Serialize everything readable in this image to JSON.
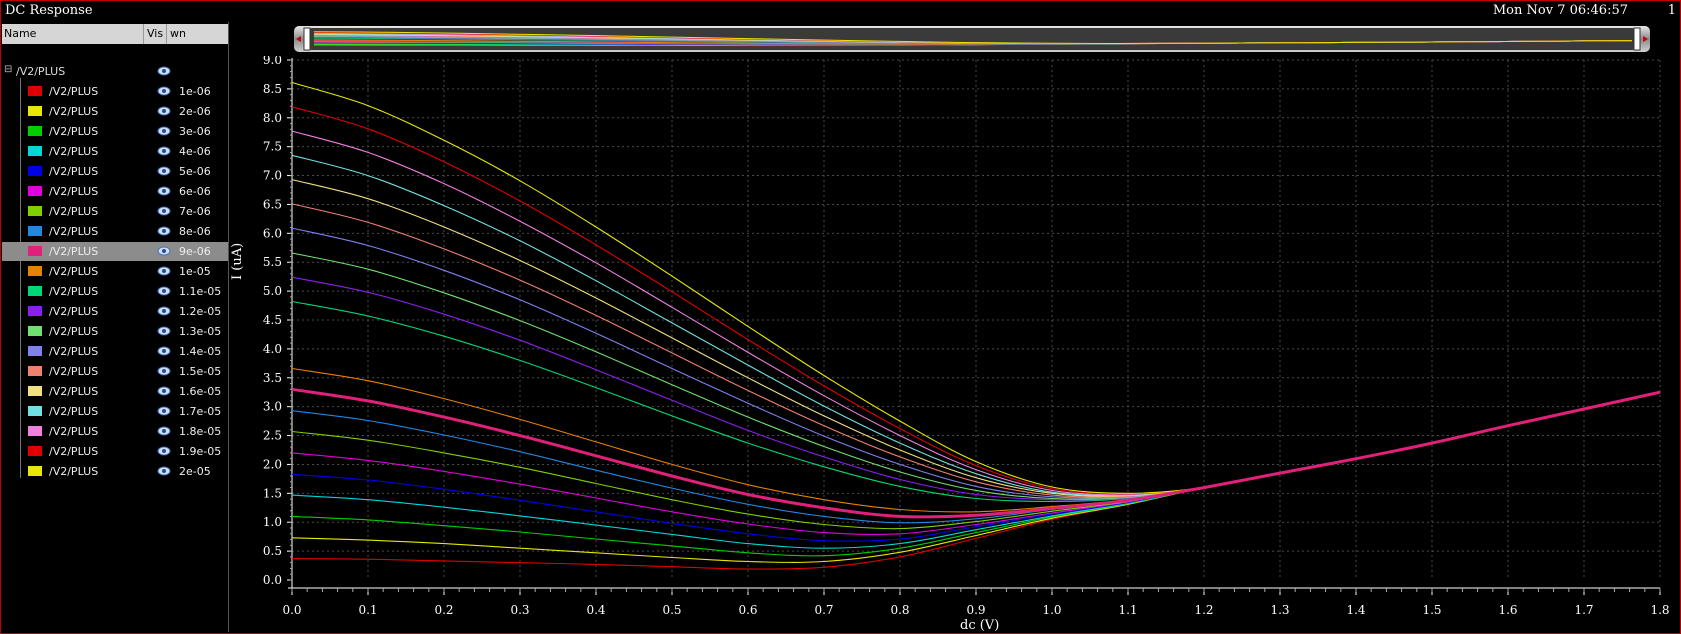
{
  "window": {
    "title": "DC Response",
    "timestamp": "Mon Nov 7 06:46:57",
    "page_number": "1"
  },
  "sidebar": {
    "headers": {
      "name": "Name",
      "vis": "Vis",
      "param": "wn"
    },
    "group": {
      "label": "/V2/PLUS",
      "expander": "⊟"
    },
    "items": [
      {
        "label": "/V2/PLUS",
        "value": "1e-06",
        "color": "#e00000"
      },
      {
        "label": "/V2/PLUS",
        "value": "2e-06",
        "color": "#e8e800"
      },
      {
        "label": "/V2/PLUS",
        "value": "3e-06",
        "color": "#00d000"
      },
      {
        "label": "/V2/PLUS",
        "value": "4e-06",
        "color": "#00d8d8"
      },
      {
        "label": "/V2/PLUS",
        "value": "5e-06",
        "color": "#0000e8"
      },
      {
        "label": "/V2/PLUS",
        "value": "6e-06",
        "color": "#e000e0"
      },
      {
        "label": "/V2/PLUS",
        "value": "7e-06",
        "color": "#80d000"
      },
      {
        "label": "/V2/PLUS",
        "value": "8e-06",
        "color": "#1e88e5"
      },
      {
        "label": "/V2/PLUS",
        "value": "9e-06",
        "color": "#e0207a",
        "selected": true
      },
      {
        "label": "/V2/PLUS",
        "value": "1e-05",
        "color": "#e88000"
      },
      {
        "label": "/V2/PLUS",
        "value": "1.1e-05",
        "color": "#00d878"
      },
      {
        "label": "/V2/PLUS",
        "value": "1.2e-05",
        "color": "#8a20f0"
      },
      {
        "label": "/V2/PLUS",
        "value": "1.3e-05",
        "color": "#70e070"
      },
      {
        "label": "/V2/PLUS",
        "value": "1.4e-05",
        "color": "#8080f0"
      },
      {
        "label": "/V2/PLUS",
        "value": "1.5e-05",
        "color": "#f08070"
      },
      {
        "label": "/V2/PLUS",
        "value": "1.6e-05",
        "color": "#f0e080"
      },
      {
        "label": "/V2/PLUS",
        "value": "1.7e-05",
        "color": "#70e0e0"
      },
      {
        "label": "/V2/PLUS",
        "value": "1.8e-05",
        "color": "#f080e0"
      },
      {
        "label": "/V2/PLUS",
        "value": "1.9e-05",
        "color": "#e00000"
      },
      {
        "label": "/V2/PLUS",
        "value": "2e-05",
        "color": "#e8e800"
      }
    ]
  },
  "chart_data": {
    "type": "line",
    "title": "",
    "xlabel": "dc (V)",
    "ylabel": "I (uA)",
    "xlim": [
      0,
      1.8
    ],
    "ylim": [
      0,
      9.0
    ],
    "x_ticks": [
      "0.0",
      "0.1",
      "0.2",
      "0.3",
      "0.4",
      "0.5",
      "0.6",
      "0.7",
      "0.8",
      "0.9",
      "1.0",
      "1.1",
      "1.2",
      "1.3",
      "1.4",
      "1.5",
      "1.6",
      "1.7",
      "1.8"
    ],
    "y_ticks": [
      "0.0",
      "0.5",
      "1.0",
      "1.5",
      "2.0",
      "2.5",
      "3.0",
      "3.5",
      "4.0",
      "4.5",
      "5.0",
      "5.5",
      "6.0",
      "6.5",
      "7.0",
      "7.5",
      "8.0",
      "8.5",
      "9.0"
    ],
    "grid": true,
    "x": [
      0.0,
      0.1,
      0.2,
      0.3,
      0.4,
      0.5,
      0.6,
      0.7,
      0.8,
      0.9,
      1.0,
      1.1,
      1.2,
      1.3,
      1.4,
      1.5,
      1.6,
      1.7,
      1.8
    ],
    "series": [
      {
        "name": "1e-06",
        "color": "#e00000",
        "values": [
          0.37,
          0.36,
          0.33,
          0.3,
          0.27,
          0.23,
          0.19,
          0.22,
          0.4,
          0.72,
          1.05,
          1.31,
          1.6,
          1.85,
          2.1,
          2.37,
          2.67,
          2.96,
          3.25
        ]
      },
      {
        "name": "2e-06",
        "color": "#e8e800",
        "values": [
          0.73,
          0.69,
          0.63,
          0.55,
          0.47,
          0.39,
          0.32,
          0.32,
          0.48,
          0.77,
          1.07,
          1.31,
          1.6,
          1.85,
          2.1,
          2.37,
          2.67,
          2.96,
          3.25
        ]
      },
      {
        "name": "3e-06",
        "color": "#00d000",
        "values": [
          1.1,
          1.04,
          0.94,
          0.83,
          0.71,
          0.59,
          0.47,
          0.42,
          0.55,
          0.82,
          1.09,
          1.32,
          1.6,
          1.85,
          2.1,
          2.37,
          2.67,
          2.96,
          3.25
        ]
      },
      {
        "name": "4e-06",
        "color": "#00d8d8",
        "values": [
          1.47,
          1.39,
          1.26,
          1.11,
          0.95,
          0.79,
          0.63,
          0.55,
          0.63,
          0.87,
          1.11,
          1.33,
          1.6,
          1.85,
          2.1,
          2.37,
          2.67,
          2.96,
          3.25
        ]
      },
      {
        "name": "5e-06",
        "color": "#0000e8",
        "values": [
          1.83,
          1.73,
          1.57,
          1.38,
          1.18,
          0.98,
          0.8,
          0.68,
          0.71,
          0.92,
          1.14,
          1.34,
          1.6,
          1.85,
          2.1,
          2.37,
          2.67,
          2.96,
          3.25
        ]
      },
      {
        "name": "6e-06",
        "color": "#e000e0",
        "values": [
          2.2,
          2.07,
          1.88,
          1.66,
          1.42,
          1.18,
          0.97,
          0.82,
          0.8,
          0.96,
          1.16,
          1.35,
          1.6,
          1.85,
          2.1,
          2.37,
          2.67,
          2.96,
          3.25
        ]
      },
      {
        "name": "7e-06",
        "color": "#80d000",
        "values": [
          2.57,
          2.42,
          2.2,
          1.95,
          1.67,
          1.39,
          1.14,
          0.96,
          0.89,
          1.01,
          1.19,
          1.36,
          1.6,
          1.85,
          2.1,
          2.37,
          2.67,
          2.96,
          3.25
        ]
      },
      {
        "name": "8e-06",
        "color": "#1e88e5",
        "values": [
          2.93,
          2.76,
          2.51,
          2.22,
          1.9,
          1.59,
          1.31,
          1.1,
          0.99,
          1.06,
          1.22,
          1.37,
          1.6,
          1.85,
          2.1,
          2.37,
          2.67,
          2.96,
          3.25
        ]
      },
      {
        "name": "9e-06",
        "color": "#e0207a",
        "values": [
          3.3,
          3.1,
          2.82,
          2.5,
          2.15,
          1.8,
          1.48,
          1.25,
          1.1,
          1.12,
          1.24,
          1.38,
          1.6,
          1.85,
          2.1,
          2.37,
          2.67,
          2.96,
          3.25
        ]
      },
      {
        "name": "1e-05",
        "color": "#e88000",
        "values": [
          3.66,
          3.45,
          3.14,
          2.78,
          2.39,
          2.0,
          1.65,
          1.39,
          1.22,
          1.18,
          1.27,
          1.39,
          1.6,
          1.85,
          2.1,
          2.37,
          2.67,
          2.96,
          3.25
        ]
      },
      {
        "name": "1.1e-05",
        "color": "#00d878",
        "values": [
          4.82,
          4.57,
          4.22,
          3.8,
          3.33,
          2.84,
          2.37,
          1.96,
          1.62,
          1.41,
          1.36,
          1.41,
          1.6,
          1.85,
          2.1,
          2.37,
          2.67,
          2.96,
          3.25
        ]
      },
      {
        "name": "1.2e-05",
        "color": "#8a20f0",
        "values": [
          5.24,
          4.98,
          4.6,
          4.15,
          3.64,
          3.11,
          2.59,
          2.13,
          1.74,
          1.48,
          1.39,
          1.42,
          1.6,
          1.85,
          2.1,
          2.37,
          2.67,
          2.96,
          3.25
        ]
      },
      {
        "name": "1.3e-05",
        "color": "#70e070",
        "values": [
          5.66,
          5.38,
          4.97,
          4.49,
          3.95,
          3.38,
          2.82,
          2.31,
          1.87,
          1.55,
          1.41,
          1.43,
          1.6,
          1.85,
          2.1,
          2.37,
          2.67,
          2.96,
          3.25
        ]
      },
      {
        "name": "1.4e-05",
        "color": "#8080f0",
        "values": [
          6.09,
          5.79,
          5.36,
          4.85,
          4.27,
          3.66,
          3.06,
          2.49,
          2.0,
          1.62,
          1.44,
          1.44,
          1.6,
          1.85,
          2.1,
          2.37,
          2.67,
          2.96,
          3.25
        ]
      },
      {
        "name": "1.5e-05",
        "color": "#f08070",
        "values": [
          6.51,
          6.19,
          5.73,
          5.19,
          4.58,
          3.93,
          3.28,
          2.67,
          2.13,
          1.7,
          1.47,
          1.45,
          1.6,
          1.85,
          2.1,
          2.37,
          2.67,
          2.96,
          3.25
        ]
      },
      {
        "name": "1.6e-05",
        "color": "#f0e080",
        "values": [
          6.93,
          6.6,
          6.11,
          5.53,
          4.88,
          4.19,
          3.5,
          2.84,
          2.25,
          1.77,
          1.5,
          1.46,
          1.6,
          1.85,
          2.1,
          2.37,
          2.67,
          2.96,
          3.25
        ]
      },
      {
        "name": "1.7e-05",
        "color": "#70e0e0",
        "values": [
          7.35,
          7.0,
          6.48,
          5.87,
          5.18,
          4.45,
          3.72,
          3.01,
          2.37,
          1.84,
          1.52,
          1.47,
          1.6,
          1.85,
          2.1,
          2.37,
          2.67,
          2.96,
          3.25
        ]
      },
      {
        "name": "1.8e-05",
        "color": "#f080e0",
        "values": [
          7.77,
          7.4,
          6.86,
          6.21,
          5.49,
          4.72,
          3.94,
          3.19,
          2.5,
          1.91,
          1.55,
          1.48,
          1.6,
          1.85,
          2.1,
          2.37,
          2.67,
          2.96,
          3.25
        ]
      },
      {
        "name": "1.9e-05",
        "color": "#e00000",
        "values": [
          8.19,
          7.81,
          7.24,
          6.56,
          5.8,
          4.99,
          4.16,
          3.36,
          2.62,
          1.98,
          1.58,
          1.49,
          1.6,
          1.85,
          2.1,
          2.37,
          2.67,
          2.96,
          3.25
        ]
      },
      {
        "name": "2e-05",
        "color": "#e8e800",
        "values": [
          8.61,
          8.21,
          7.61,
          6.91,
          6.11,
          5.26,
          4.39,
          3.54,
          2.75,
          2.05,
          1.61,
          1.5,
          1.6,
          1.85,
          2.1,
          2.37,
          2.67,
          2.96,
          3.25
        ]
      }
    ],
    "highlighted_series": "9e-06"
  }
}
